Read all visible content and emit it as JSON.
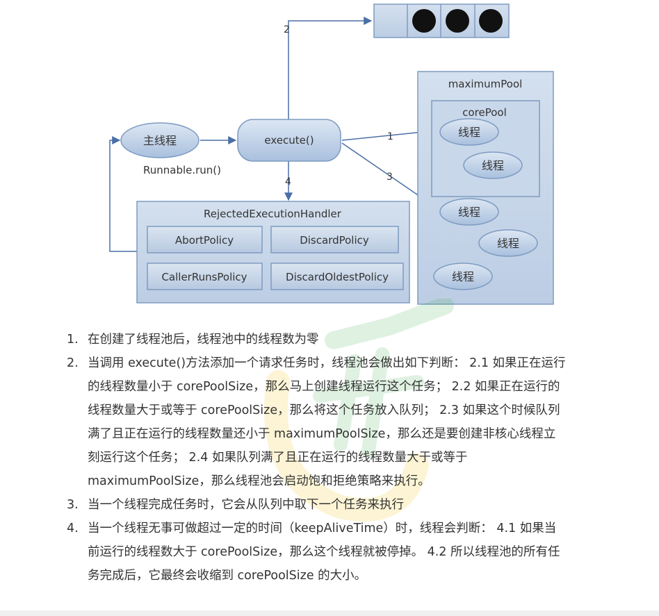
{
  "diagram": {
    "main_thread": "主线程",
    "runnable_label": "Runnable.run()",
    "execute": "execute()",
    "max_pool": "maximumPool",
    "core_pool": "corePool",
    "thread": "线程",
    "rejected_handler": "RejectedExecutionHandler",
    "policies": {
      "abort": "AbortPolicy",
      "discard": "DiscardPolicy",
      "caller_runs": "CallerRunsPolicy",
      "discard_oldest": "DiscardOldestPolicy"
    },
    "arrows": {
      "a1": "1",
      "a2": "2",
      "a3": "3",
      "a4": "4"
    }
  },
  "steps": [
    {
      "num": "1.",
      "text": "在创建了线程池后，线程池中的线程数为零"
    },
    {
      "num": "2.",
      "text": "当调用 execute()方法添加一个请求任务时，线程池会做出如下判断： 2.1 如果正在运行的线程数量小于 corePoolSize，那么马上创建线程运行这个任务； 2.2 如果正在运行的线程数量大于或等于 corePoolSize，那么将这个任务放入队列； 2.3 如果这个时候队列满了且正在运行的线程数量还小于 maximumPoolSize，那么还是要创建非核心线程立刻运行这个任务； 2.4 如果队列满了且正在运行的线程数量大于或等于 maximumPoolSize，那么线程池会启动饱和拒绝策略来执行。"
    },
    {
      "num": "3.",
      "text": "当一个线程完成任务时，它会从队列中取下一个任务来执行"
    },
    {
      "num": "4.",
      "text": "当一个线程无事可做超过一定的时间（keepAliveTime）时，线程会判断： 4.1 如果当前运行的线程数大于 corePoolSize，那么这个线程就被停掉。 4.2 所以线程池的所有任务完成后，它最终会收缩到 corePoolSize 的大小。"
    }
  ],
  "colors": {
    "box_fill": "#c6d6ea",
    "box_stroke": "#7d9bc1",
    "arrow": "#4a6fa5",
    "dark": "#111111",
    "text": "#333333"
  }
}
